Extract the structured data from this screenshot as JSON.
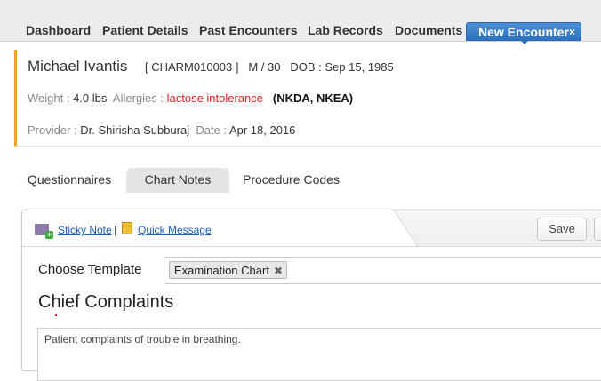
{
  "tabs": {
    "dashboard": "Dashboard",
    "patient_details": "Patient Details",
    "past_encounters": "Past Encounters",
    "lab_records": "Lab Records",
    "documents": "Documents",
    "new_encounter": "New Encounter",
    "close_glyph": "×"
  },
  "patient": {
    "name": "Michael Ivantis",
    "id": "[ CHARM010003 ]",
    "sex_age": "M / 30",
    "dob_label": "DOB :",
    "dob": "Sep 15, 1985",
    "weight_label": "Weight :",
    "weight": "4.0 lbs",
    "allergies_label": "Allergies :",
    "allergies": "lactose intolerance",
    "allergy_flags": "(NKDA, NKEA)",
    "provider_label": "Provider :",
    "provider": "Dr. Shirisha Subburaj",
    "date_label": "Date :",
    "date": "Apr 18, 2016"
  },
  "subtabs": {
    "questionnaires": "Questionnaires",
    "chart_notes": "Chart Notes",
    "procedure_codes": "Procedure Codes"
  },
  "toolbar": {
    "sticky_note": "Sticky Note",
    "separator": "|",
    "quick_message": "Quick Message",
    "save": "Save"
  },
  "template": {
    "label": "Choose Template",
    "selected": "Examination Chart",
    "remove_glyph": "✖"
  },
  "chief_complaints": {
    "title": "Chief Complaints",
    "text": "Patient complaints of trouble in breathing."
  },
  "colors": {
    "active_tab": "#2f72bf",
    "accent_border": "#f2a322",
    "allergy": "#e02020",
    "link": "#1a5fb4"
  }
}
